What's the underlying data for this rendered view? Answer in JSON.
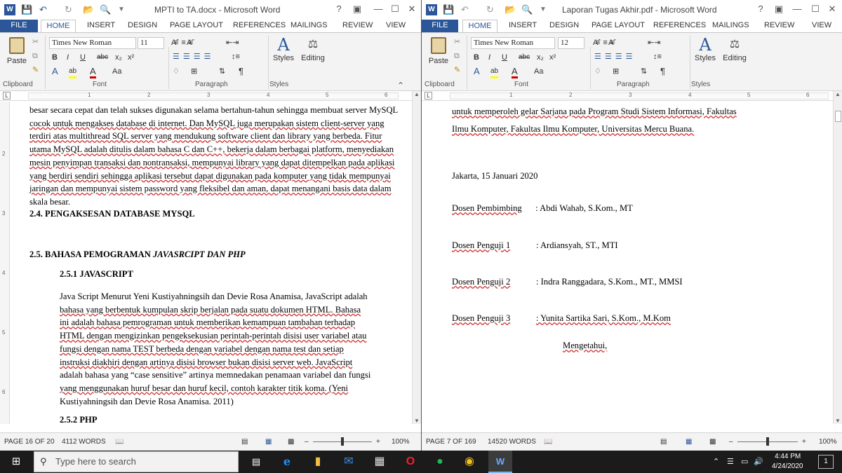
{
  "left_window": {
    "title": "MPTI to TA.docx - Microsoft Word",
    "help": "?",
    "tabs": [
      "FILE",
      "HOME",
      "INSERT",
      "DESIGN",
      "PAGE LAYOUT",
      "REFERENCES",
      "MAILINGS",
      "REVIEW",
      "VIEW"
    ],
    "font_name": "Times New Roman",
    "font_size": "11",
    "groups": {
      "clipboard": "Clipboard",
      "font": "Font",
      "paragraph": "Paragraph",
      "styles": "Styles"
    },
    "paste": "Paste",
    "styles_btn": "Styles",
    "editing_btn": "Editing",
    "ruler_numbers": [
      "1",
      "2",
      "3",
      "4",
      "5",
      "6"
    ],
    "lines": [
      "besar secara cepat dan telah sukses digunakan selama bertahun-tahun sehingga membuat server MySQL",
      "cocok untuk mengakses database di internet. Dan MySQL juga merupakan sistem client-server yang",
      "terdiri atas multithread SQL server yang mendukung software client dan library yang berbeda. Fitur",
      "utama MySQL adalah ditulis dalam bahasa C dan C++, bekerja dalam berbagai platform, menyediakan",
      "mesin penyimpan transaksi dan nontransaksi, mempunyai library yang dapat ditempelkan pada aplikasi",
      "yang berdiri sendiri sehingga aplikasi tersebut dapat digunakan pada komputer yang tidak mempunyai",
      "jaringan dan mempunyai sistem password yang fleksibel dan aman, dapat menangani basis data dalam",
      "skala besar."
    ],
    "heading_24": "2.4. PENGAKSESAN DATABASE MYSQL",
    "heading_25_a": "2.5. BAHASA PEMOGRAMAN ",
    "heading_25_b": "JAVASRCIPT DAN PHP",
    "heading_251": "2.5.1 JAVASCRIPT",
    "para_js": [
      "Java Script Menurut Yeni Kustiyahningsih dan Devie Rosa Anamisa, JavaScript adalah",
      "bahasa yang berbentuk kumpulan skrip berjalan pada suatu dokumen HTML. Bahasa",
      "ini adalah bahasa pemrograman untuk memberikan kemampuan tambahan terhadap",
      "HTML dengan mengizinkan pengeksekusian perintah-perintah disisi user variabel atau",
      "fungsi dengan nama TEST berbeda dengan variabel dengan nama test dan setiap",
      "instruksi diakhiri dengan artinya disisi browser bukan disisi server web. JavaScript",
      "adalah bahasa yang “case sensitive” artinya memnedakan penamaan variabel dan fungsi",
      "yang menggunakan huruf besar dan huruf kecil, contoh karakter titik koma. (Yeni",
      "Kustiyahningsih dan Devie Rosa Anamisa. 2011)"
    ],
    "heading_252": "2.5.2 PHP",
    "status_page": "PAGE 16 OF 20",
    "status_words": "4112 WORDS",
    "zoom": "100%",
    "zoom_level": 0.5
  },
  "right_window": {
    "title": "Laporan Tugas Akhir.pdf - Microsoft Word",
    "help": "?",
    "tabs": [
      "FILE",
      "HOME",
      "INSERT",
      "DESIGN",
      "PAGE LAYOUT",
      "REFERENCES",
      "MAILINGS",
      "REVIEW",
      "VIEW"
    ],
    "font_name": "Times New Roman",
    "font_size": "12",
    "groups": {
      "clipboard": "Clipboard",
      "font": "Font",
      "paragraph": "Paragraph",
      "styles": "Styles"
    },
    "paste": "Paste",
    "styles_btn": "Styles",
    "editing_btn": "Editing",
    "ruler_numbers": [
      "1",
      "2",
      "3",
      "4",
      "5",
      "6"
    ],
    "line1": "untuk memperoleh gelar Sarjana pada Program Studi Sistem Informasi, Fakultas",
    "line2": "Ilmu Komputer, Fakultas Ilmu Komputer, Universitas Mercu Buana.",
    "place_date": "Jakarta, 15  Januari 2020",
    "rows": [
      {
        "label": "Dosen Pembimbing",
        "value": "  : Abdi Wahab, S.Kom., MT"
      },
      {
        "label": "Dosen Penguji 1",
        "value": ":  Ardiansyah, ST., MTI"
      },
      {
        "label": "Dosen Penguji 2",
        "value": ": Indra Ranggadara, S.Kom., MT., MMSI"
      },
      {
        "label": "Dosen Penguji 3",
        "value": ": Yunita Sartika Sari, S.Kom., M.Kom"
      }
    ],
    "mengetahui": "Mengetahui,",
    "status_page": "PAGE 7 OF 169",
    "status_words": "14520 WORDS",
    "zoom": "100%",
    "zoom_level": 0.5
  },
  "taskbar": {
    "search_placeholder": "Type here to search",
    "time": "4:44 PM",
    "date": "4/24/2020",
    "notif": "1",
    "icons": [
      "windows-start-icon",
      "search-icon",
      "task-view-icon",
      "edge-icon",
      "file-explorer-icon",
      "mail-icon",
      "store-icon",
      "opera-icon",
      "spotify-icon",
      "chrome-icon",
      "word-icon"
    ]
  }
}
